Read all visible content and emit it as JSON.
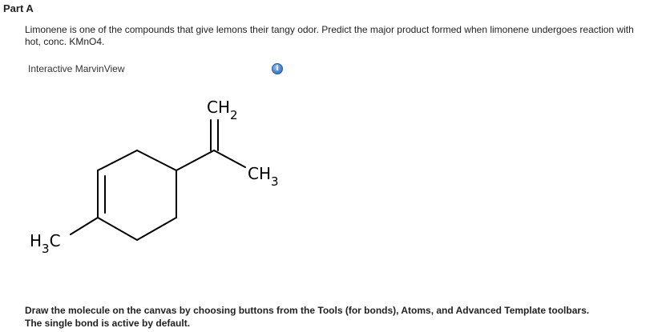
{
  "part": {
    "title": "Part A"
  },
  "question": {
    "text": "Limonene is one of the compounds that give lemons their tangy odor. Predict the major product formed when limonene undergoes reaction with hot, conc. KMnO4."
  },
  "viewer": {
    "label": "Interactive MarvinView",
    "info_icon": "info-icon",
    "info_glyph": "i"
  },
  "molecule": {
    "name": "limonene",
    "labels": {
      "ch2_main": "CH",
      "ch2_sub": "2",
      "ch3_main": "CH",
      "ch3_sub": "3",
      "h3c_h": "H",
      "h3c_sub": "3",
      "h3c_c": "C"
    }
  },
  "instructions": {
    "line1": "Draw the molecule on the canvas by choosing buttons from the Tools (for bonds), Atoms, and Advanced Template toolbars.",
    "line2": "The single bond is active by default."
  }
}
